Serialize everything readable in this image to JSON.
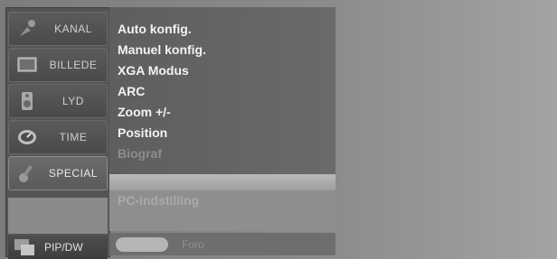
{
  "categories": [
    {
      "label": "KANAL",
      "icon": "satellite-dish-icon"
    },
    {
      "label": "BILLEDE",
      "icon": "monitor-icon"
    },
    {
      "label": "LYD",
      "icon": "speaker-icon"
    },
    {
      "label": "TIME",
      "icon": "clock-icon"
    },
    {
      "label": "SPECIAL",
      "icon": "guitar-icon"
    }
  ],
  "pip": {
    "label": "PIP/DW",
    "icon": "pip-icon"
  },
  "menu": {
    "items": [
      "Auto konfig.",
      "Manuel konfig.",
      "XGA Modus",
      "ARC",
      "Zoom +/-",
      "Position",
      "Biograf"
    ],
    "submenu": "PC-indstilling"
  },
  "bottom": {
    "label": "Foro"
  },
  "colors": {
    "panel": "#555555",
    "menu": "#666666",
    "text": "#f2f2f2"
  }
}
